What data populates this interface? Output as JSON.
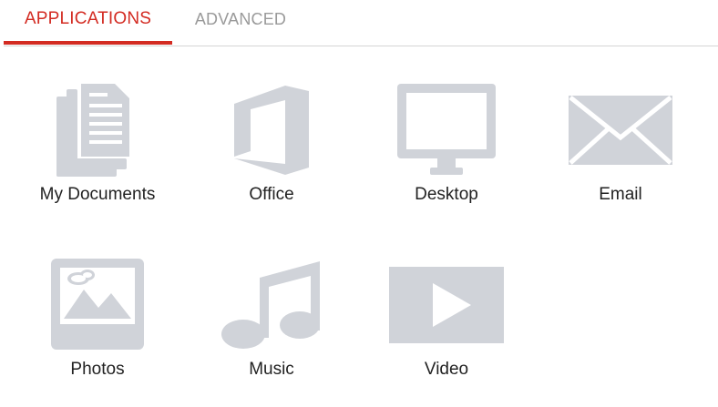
{
  "tabs": [
    {
      "label": "APPLICATIONS",
      "active": true
    },
    {
      "label": "ADVANCED",
      "active": false
    }
  ],
  "apps": [
    {
      "label": "My Documents",
      "icon": "documents-icon"
    },
    {
      "label": "Office",
      "icon": "office-icon"
    },
    {
      "label": "Desktop",
      "icon": "monitor-icon"
    },
    {
      "label": "Email",
      "icon": "envelope-icon"
    },
    {
      "label": "Photos",
      "icon": "photo-icon"
    },
    {
      "label": "Music",
      "icon": "music-note-icon"
    },
    {
      "label": "Video",
      "icon": "play-icon"
    }
  ],
  "colors": {
    "accent": "#d32b22",
    "icon_gray": "#d0d3d9",
    "inactive_tab": "#9a9a9a",
    "label": "#222222"
  }
}
